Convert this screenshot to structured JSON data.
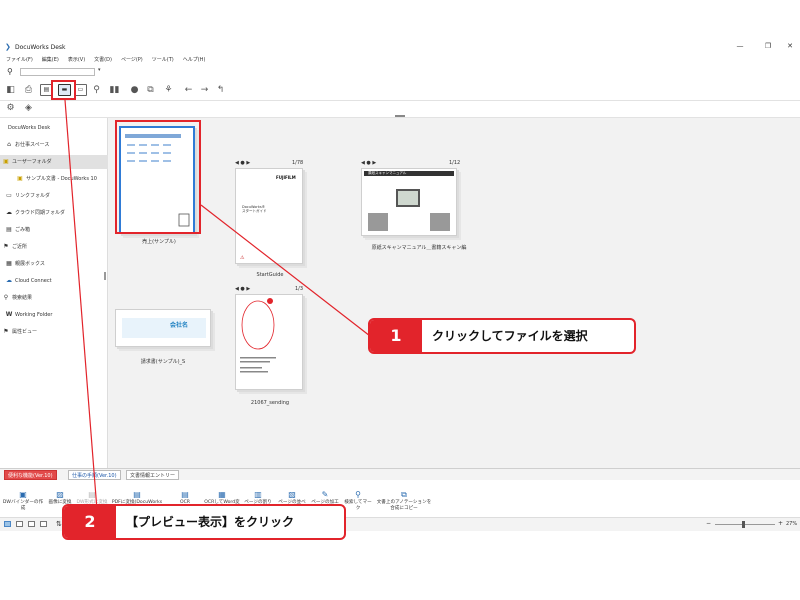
{
  "window": {
    "title": "DocuWorks Desk",
    "minimize": "—",
    "maximize": "❐",
    "close": "✕"
  },
  "menu": [
    "ファイル(F)",
    "編集(E)",
    "表示(V)",
    "文書(D)",
    "ページ(P)",
    "ツール(T)",
    "ヘルプ(H)"
  ],
  "search": {
    "placeholder": ""
  },
  "sidebar": {
    "items": [
      {
        "label": "DocuWorks Desk",
        "icon": ""
      },
      {
        "label": "お仕事スペース",
        "icon": "⌂"
      },
      {
        "label": "ユーザーフォルダ",
        "icon": "▣"
      },
      {
        "label": "サンプル文書 - DocuWorks 10",
        "icon": "▣"
      },
      {
        "label": "リンクフォルダ",
        "icon": "▭"
      },
      {
        "label": "クラウド同期フォルダ",
        "icon": "☁"
      },
      {
        "label": "ごみ箱",
        "icon": "▤"
      },
      {
        "label": "ご近所",
        "icon": "⚑"
      },
      {
        "label": "親展ボックス",
        "icon": "▦"
      },
      {
        "label": "Cloud Connect",
        "icon": "☁"
      },
      {
        "label": "検索結果",
        "icon": "⚲"
      },
      {
        "label": "Working Folder",
        "icon": "W"
      },
      {
        "label": "属性ビュー",
        "icon": "⚑"
      }
    ]
  },
  "documents": [
    {
      "label": "売上(サンプル)",
      "pages": ""
    },
    {
      "label": "StartGuide",
      "pages": "1/78",
      "brand": "FUJIFILM",
      "cover_text": "DocuWorks®\nスタートガイド"
    },
    {
      "label": "原紙スキャンマニュアル＿書籍スキャン編",
      "pages": "1/12",
      "cover_text": "原紙スキャンマニュアル"
    },
    {
      "label": "請求書(サンプル)_S",
      "pages": "",
      "cover_text": "会社名"
    },
    {
      "label": "21067_sending",
      "pages": "1/3"
    }
  ],
  "tabs": [
    {
      "label": "便利な機能(Ver.10)"
    },
    {
      "label": "仕事の手順(Ver.10)"
    },
    {
      "label": "文書情報エントリー"
    }
  ],
  "plugins": [
    {
      "label": "DWバインダーの作成"
    },
    {
      "label": "画像に変換"
    },
    {
      "label": "DW形式に変換"
    },
    {
      "label": "PDFに変換(DocuWorks PDF)"
    },
    {
      "label": "OCR"
    },
    {
      "label": "OCRしてWord変換"
    },
    {
      "label": "ページの割り付け"
    },
    {
      "label": "ページの並べ替え"
    },
    {
      "label": "ページの加工"
    },
    {
      "label": "検索してマーク"
    },
    {
      "label": "文書上のアノテーションを合成にコピー"
    }
  ],
  "status": {
    "zoom": "27%"
  },
  "callouts": [
    {
      "number": "1",
      "text": "クリックしてファイルを選択"
    },
    {
      "number": "2",
      "text": "【プレビュー表示】をクリック"
    }
  ],
  "colors": {
    "annotation_red": "#e2242b",
    "active_tab": "#e24a4a",
    "accent_blue": "#2b6cb0"
  }
}
